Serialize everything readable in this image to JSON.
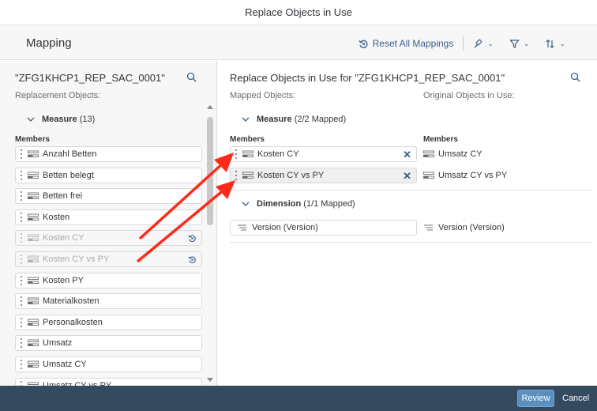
{
  "dialog": {
    "title": "Replace Objects in Use"
  },
  "header": {
    "title": "Mapping",
    "reset_label": "Reset All Mappings"
  },
  "left": {
    "title": "\"ZFG1KHCP1_REP_SAC_0001\"",
    "subtitle": "Replacement Objects:",
    "group": {
      "name": "Measure",
      "count": "(13)"
    },
    "members_label": "Members",
    "items": [
      {
        "label": "Anzahl Betten",
        "state": "available"
      },
      {
        "label": "Betten belegt",
        "state": "available"
      },
      {
        "label": "Betten frei",
        "state": "available"
      },
      {
        "label": "Kosten",
        "state": "available"
      },
      {
        "label": "Kosten CY",
        "state": "mapped"
      },
      {
        "label": "Kosten CY vs PY",
        "state": "mapped"
      },
      {
        "label": "Kosten PY",
        "state": "available"
      },
      {
        "label": "Materialkosten",
        "state": "available"
      },
      {
        "label": "Personalkosten",
        "state": "available"
      },
      {
        "label": "Umsatz",
        "state": "available"
      },
      {
        "label": "Umsatz CY",
        "state": "available"
      },
      {
        "label": "Umsatz CY vs PY",
        "state": "available"
      }
    ]
  },
  "right": {
    "title": "Replace Objects in Use for \"ZFG1KHCP1_REP_SAC_0001\"",
    "mapped_label": "Mapped Objects:",
    "original_label": "Original Objects in Use:",
    "measure_group": {
      "name": "Measure",
      "status": "(2/2 Mapped)"
    },
    "members_left": "Members",
    "members_right": "Members",
    "measure_rows": [
      {
        "mapped": "Kosten CY",
        "original": "Umsatz CY"
      },
      {
        "mapped": "Kosten CY vs PY",
        "original": "Umsatz CY vs PY"
      }
    ],
    "dimension_group": {
      "name": "Dimension",
      "status": "(1/1 Mapped)"
    },
    "dimension_rows": [
      {
        "mapped": "Version (Version)",
        "original": "Version (Version)"
      }
    ]
  },
  "footer": {
    "review_label": "Review",
    "cancel_label": "Cancel"
  },
  "colors": {
    "accent": "#3a5f8c",
    "footer_bg": "#354a5f",
    "review_button": "#5b8fbf",
    "annotation_arrow": "#ff2a1a"
  },
  "icons": {
    "search": "search-icon",
    "reset": "reset-icon",
    "brush": "brush-icon",
    "filter": "filter-icon",
    "sort": "sort-icon",
    "measure": "measure-icon",
    "dimension": "dimension-icon",
    "restore": "restore-icon",
    "remove": "close-icon"
  }
}
